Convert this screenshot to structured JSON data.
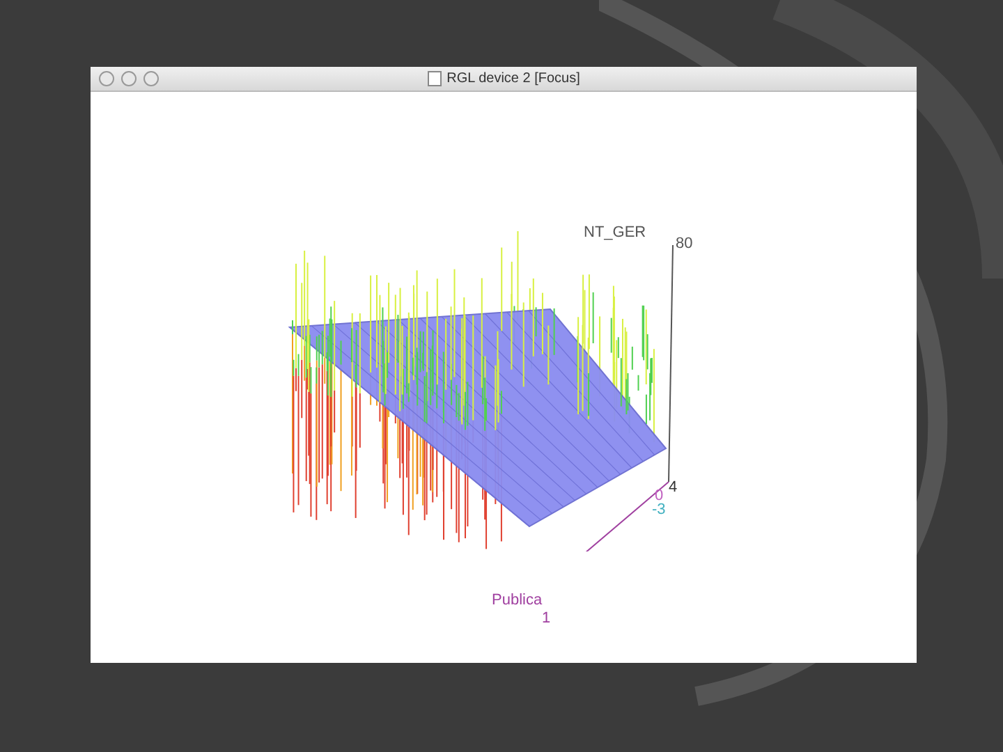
{
  "window": {
    "title": "RGL device 2 [Focus]"
  },
  "plot": {
    "z_axis": {
      "title": "NT_GER",
      "ticks": [
        "80",
        "4"
      ]
    },
    "x_axis": {
      "ticks": [
        "0",
        "-3"
      ]
    },
    "y_axis": {
      "title": "Publica",
      "ticks": [
        "1"
      ]
    }
  }
}
